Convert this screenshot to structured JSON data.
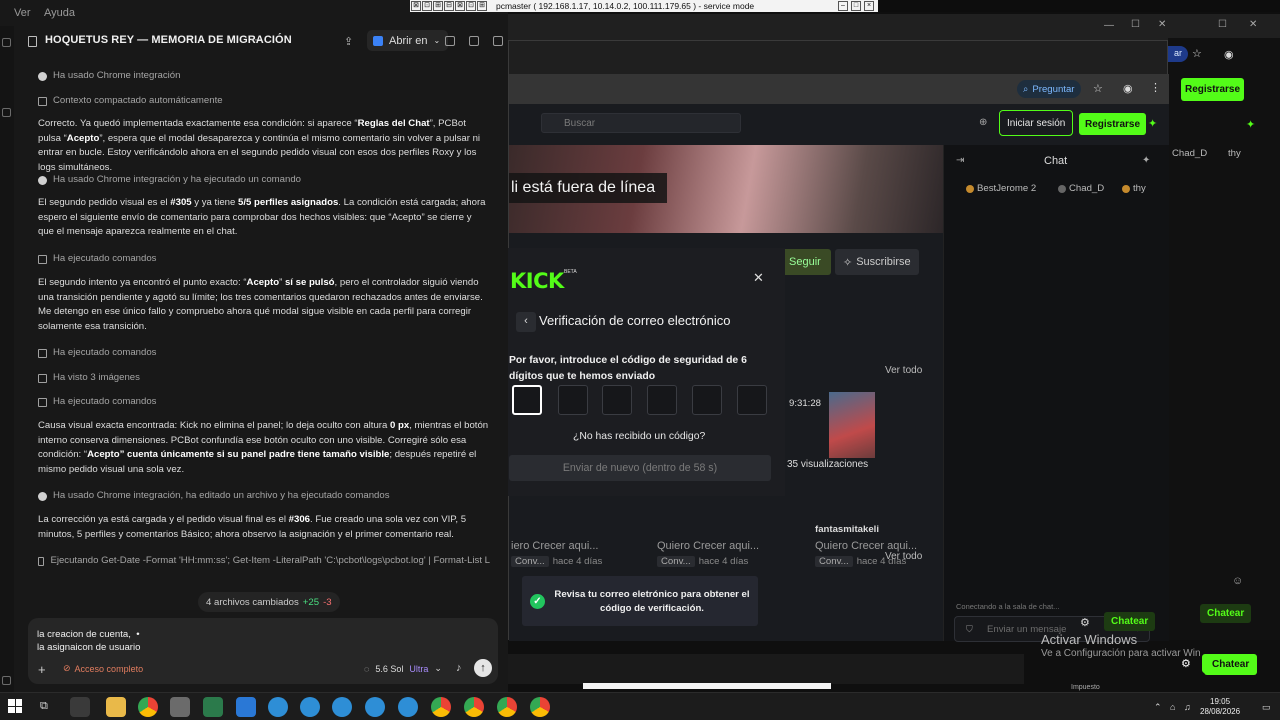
{
  "menubar": {
    "items": [
      "Ver",
      "Ayuda"
    ]
  },
  "remote": {
    "title": "pcmaster ( 192.168.1.17, 10.14.0.2, 100.111.179.65 ) - service mode"
  },
  "chat_app": {
    "title": "HOQUETUS REY — MEMORIA DE MIGRACIÓN",
    "open_in_label": "Abrir en",
    "messages": [
      {
        "type": "activity",
        "text": "Ha usado Chrome integración"
      },
      {
        "type": "activity",
        "text": "Contexto compactado automáticamente"
      },
      {
        "type": "text",
        "html_parts": [
          "Correcto. Ya quedó implementada exactamente esa condición: si aparece “",
          "Reglas del Chat",
          "”, PCBot pulsa “",
          "Acepto",
          "”, espera que el modal desaparezca y continúa el mismo comentario sin volver a pulsar ni entrar en bucle. Estoy verificándolo ahora en el segundo pedido visual con esos dos perfiles Roxy y los logs simultáneos."
        ]
      },
      {
        "type": "activity",
        "text": "Ha usado Chrome integración y ha ejecutado un comando"
      },
      {
        "type": "text",
        "html_parts": [
          "El segundo pedido visual es el ",
          "#305",
          " y ya tiene ",
          "5/5 perfiles asignados",
          ". La condición está cargada; ahora espero el siguiente envío de comentario para comprobar dos hechos visibles: que “Acepto” se cierre y que el mensaje aparezca realmente en el chat."
        ]
      },
      {
        "type": "activity",
        "text": "Ha ejecutado comandos"
      },
      {
        "type": "text",
        "html_parts": [
          "El segundo intento ya encontró el punto exacto: “",
          "Acepto",
          "” ",
          "sí se pulsó",
          ", pero el controlador siguió viendo una transición pendiente y agotó su límite; los tres comentarios quedaron rechazados antes de enviarse. Me detengo en ese único fallo y compruebo ahora qué modal sigue visible en cada perfil para corregir solamente esa transición."
        ]
      },
      {
        "type": "activity",
        "text": "Ha ejecutado comandos"
      },
      {
        "type": "activity",
        "text": "Ha visto 3 imágenes"
      },
      {
        "type": "activity",
        "text": "Ha ejecutado comandos"
      },
      {
        "type": "text",
        "html_parts": [
          "Causa visual exacta encontrada: Kick no elimina el panel; lo deja oculto con altura ",
          "0 px",
          ", mientras el botón interno conserva dimensiones. PCBot confundía ese botón oculto con uno visible. Corregiré sólo esa condición: “",
          "Acepto” cuenta únicamente si su panel padre tiene tamaño visible",
          "; después repetiré el mismo pedido visual una sola vez."
        ]
      },
      {
        "type": "activity",
        "text": "Ha usado Chrome integración, ha editado un archivo y ha ejecutado comandos"
      },
      {
        "type": "text",
        "html_parts": [
          "La corrección ya está cargada y el pedido visual final es el ",
          "#306",
          ". Fue creado una sola vez con VIP, 5 minutos, 5 perfiles y comentarios Básico; ahora observo la asignación y el primer comentario real."
        ]
      },
      {
        "type": "activity",
        "text": "Ejecutando Get-Date -Format 'HH:mm:ss'; Get-Item -LiteralPath 'C:\\pcbot\\logs\\pcbot.log' | Format-List L"
      }
    ],
    "files_changed": {
      "label": "4 archivos cambiados",
      "added": "+25",
      "removed": "-3"
    },
    "composer": {
      "text": "la creacion de cuenta,  •\nla asignaicon de usuario",
      "access": "Acceso completo",
      "model": "5.6 Sol",
      "tier": "Ultra"
    }
  },
  "browser": {
    "pregunta_label": "Preguntar",
    "search_placeholder": "Buscar",
    "login_label": "Iniciar sesión",
    "register_label": "Registrarse",
    "offline_text": "li está fuera de línea",
    "follow_label": "Seguir",
    "subscribe_label": "Suscribirse",
    "see_all_label": "Ver todo",
    "time_label": "9:31:28",
    "views_label": "35 visualizaciones",
    "channel_label": "fantasmitakeli",
    "videos": [
      {
        "title": "iero Crecer aqui...",
        "chip": "Conv...",
        "age": "hace 4 días"
      },
      {
        "title": "Quiero Crecer aqui...",
        "chip": "Conv...",
        "age": "hace 4 días"
      },
      {
        "title": "Quiero Crecer aqui...",
        "chip": "Conv...",
        "age": "hace 4 días"
      }
    ],
    "chat": {
      "title": "Chat",
      "users": [
        "BestJerome 2",
        "Chad_D",
        "thy"
      ],
      "connecting": "Conectando a la sala de chat...",
      "input_placeholder": "Enviar un mensaje",
      "send_label": "Chatear"
    }
  },
  "modal": {
    "logo": "KICK",
    "beta": "BETA",
    "title": "Verificación de correo electrónico",
    "prompt": "Por favor, introduce el código de seguridad de 6 dígitos que te hemos enviado",
    "code_length": 6,
    "no_code": "¿No has recibido un código?",
    "resend": "Enviar de nuevo (dentro de 58 s)"
  },
  "toast": {
    "text": "Revisa tu correo eletrónico para obtener el código de verificación."
  },
  "background": {
    "top_right_users": [
      "Chad_D",
      "thy"
    ],
    "top_register": "Registrarse",
    "chatear_1": "Chatear",
    "chatear_2": "Chatear",
    "chatear_3": "Chatear",
    "activate_title": "Activar Windows",
    "activate_sub": "Ve a Configuración para activar Win",
    "impuesto": "Impuesto"
  },
  "taskbar": {
    "time": "19:05",
    "date": "28/08/2026",
    "apps": [
      "search",
      "task-view",
      "app-1",
      "file-explorer",
      "chrome",
      "app-2",
      "app-3",
      "app-4",
      "app-5",
      "app-6",
      "app-7",
      "app-8",
      "app-9",
      "chrome",
      "chrome",
      "chrome"
    ]
  }
}
